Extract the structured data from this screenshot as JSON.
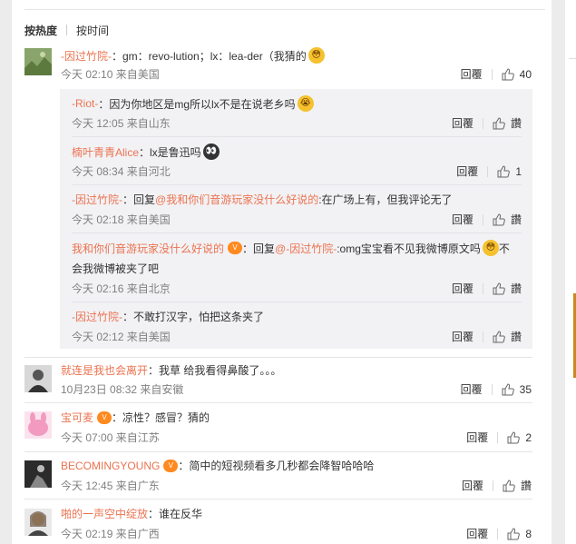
{
  "sort": {
    "hot": "按热度",
    "time": "按时间"
  },
  "actions": {
    "reply": "回覆",
    "like_label": "讚"
  },
  "comments": [
    {
      "user": "-因过竹院-",
      "text": "：gm：revo-lution；lx：lea-der（我猜的",
      "emoji": "😳",
      "time": "今天 02:10 来自美国",
      "likes": "40"
    },
    {
      "user": "就连是我也会离开",
      "text": "：我草 给我看得鼻酸了。。。",
      "time": "10月23日 08:32 来自安徽",
      "likes": "35"
    },
    {
      "user": "宝可麦",
      "text": "：凉性？感冒？猜的",
      "time": "今天 07:00 来自江苏",
      "likes": "2"
    },
    {
      "user": "BECOMINGYOUNG",
      "text": "：简中的短视频看多几秒都会降智哈哈哈",
      "time": "今天 12:45 来自广东",
      "likes": "讚"
    },
    {
      "user": "啪的一声空中绽放",
      "text": "：谁在反华",
      "time": "今天 02:19 来自广西",
      "likes": "8"
    }
  ],
  "replies": [
    {
      "user": "-Riot-",
      "text": "：因为你地区是mg所以lx不是在说老乡吗",
      "emoji": "😭",
      "time": "今天 12:05 来自山东",
      "likes": "讚"
    },
    {
      "user": "楠叶青青Alice",
      "text": "：lx是鲁迅吗",
      "emoji": "👀",
      "time": "今天 08:34 来自河北",
      "likes": "1"
    },
    {
      "user": "-因过竹院-",
      "text_prefix": "：回复",
      "mention": "@我和你们音游玩家没什么好说的",
      "text": ":在广场上有，但我评论无了",
      "time": "今天 02:18 来自美国",
      "likes": "讚"
    },
    {
      "user": "我和你们音游玩家没什么好说的",
      "text_prefix": "：回复",
      "mention": "@-因过竹院-",
      "text": ":omg宝宝看不见我微博原文吗",
      "emoji": "😳",
      "text_after": "不",
      "line2": "会我微博被夹了吧",
      "time": "今天 02:16 来自北京",
      "likes": "讚"
    },
    {
      "user": "-因过竹院-",
      "text": "：不敢打汉字，怕把这条夹了",
      "time": "今天 02:12 来自美国",
      "likes": "讚"
    }
  ],
  "colors": {
    "username": "#eb7350",
    "meta": "#808080",
    "reply_bg": "#f2f2f5"
  }
}
